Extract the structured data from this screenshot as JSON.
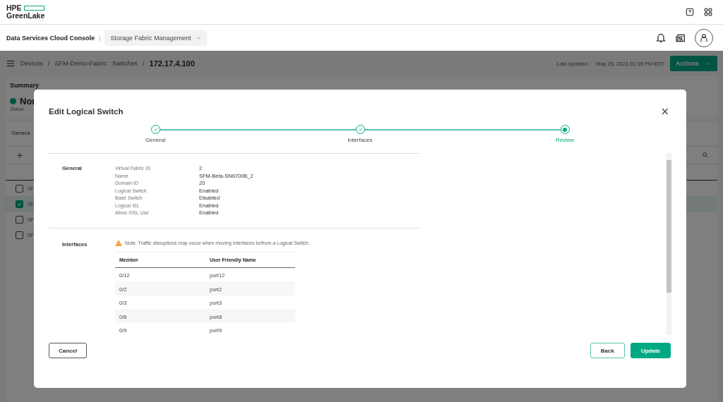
{
  "brand": {
    "top": "HPE",
    "bottom": "GreenLake"
  },
  "console": {
    "title": "Data Services Cloud Console",
    "separator": "|",
    "service": "Storage Fabric Management"
  },
  "breadcrumb": {
    "items": [
      "Devices",
      "SFM-Demo-Fabric : Switches"
    ],
    "separator": "/",
    "current": "172.17.4.100"
  },
  "last_updated": {
    "label": "Last updated :",
    "value": "May 25, 2023 01:39 PM EDT"
  },
  "actions_button": "Actions",
  "summary": {
    "title": "Summary",
    "status": "Nor",
    "status_label": "Status"
  },
  "background_table": {
    "tab": "Genera",
    "add": "+",
    "rows": [
      {
        "name": "SF",
        "checked": false
      },
      {
        "name": "SF",
        "checked": true
      },
      {
        "name": "SF",
        "checked": false
      },
      {
        "name": "SF",
        "checked": false
      }
    ]
  },
  "dialog": {
    "title": "Edit Logical Switch",
    "close": "×",
    "steps": [
      {
        "label": "General",
        "complete": true,
        "selected": false
      },
      {
        "label": "Interfaces",
        "complete": true,
        "selected": false
      },
      {
        "label": "Review",
        "complete": false,
        "selected": true
      }
    ],
    "general": {
      "heading": "General",
      "fields": [
        {
          "label": "Virtual Fabric ID",
          "value": "2"
        },
        {
          "label": "Name",
          "value": "SFM-Beta-SN6700B_2"
        },
        {
          "label": "Domain ID",
          "value": "20"
        },
        {
          "label": "Logical Switch",
          "value": "Enabled"
        },
        {
          "label": "Base Switch",
          "value": "Disabled"
        },
        {
          "label": "Logical ISL",
          "value": "Enabled"
        },
        {
          "label": "Allow XISL Use",
          "value": "Enabled"
        }
      ]
    },
    "interfaces": {
      "heading": "Interfaces",
      "note": "Note: Traffic disruptions may occur when moving Interfaces to/from a Logical Switch.",
      "columns": [
        "Member",
        "User Friendly Name"
      ],
      "rows": [
        [
          "0/12",
          "port12"
        ],
        [
          "0/2",
          "port2"
        ],
        [
          "0/3",
          "port3"
        ],
        [
          "0/8",
          "port8"
        ],
        [
          "0/9",
          "port9"
        ]
      ]
    },
    "buttons": {
      "cancel": "Cancel",
      "back": "Back",
      "update": "Update"
    }
  }
}
